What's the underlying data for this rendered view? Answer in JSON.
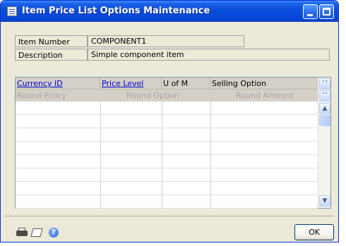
{
  "window": {
    "title": "Item Price List Options Maintenance"
  },
  "fields": {
    "item_number_label": "Item Number",
    "item_number_value": "COMPONENT1",
    "description_label": "Description",
    "description_value": "Simple component item"
  },
  "grid": {
    "header_row1": [
      "Currency ID",
      "Price Level",
      "U of M",
      "Selling Option"
    ],
    "header_row2": [
      "Round Policy",
      "Round Option",
      "Round Amount"
    ],
    "row_count": 8
  },
  "footer": {
    "ok_label": "OK"
  },
  "icons": {
    "window_icon": "window-icon",
    "printer": "printer-icon",
    "note": "note-icon",
    "help": "help-icon"
  },
  "colors": {
    "titlebar": "#0a4ad7",
    "link": "#0000cc",
    "disabled_text": "#a7a6a0"
  }
}
